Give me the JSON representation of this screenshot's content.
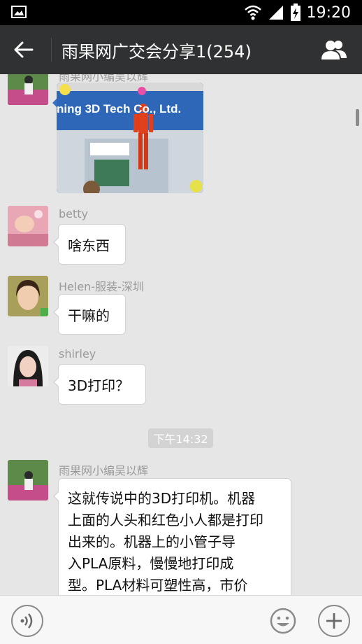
{
  "status_bar": {
    "time": "19:20",
    "icons": [
      "image-icon",
      "wifi-icon",
      "signal-icon",
      "battery-charging-icon"
    ]
  },
  "header": {
    "back_icon": "arrow-left-icon",
    "title": "雨果网广交会分享1(254)",
    "members_icon": "people-icon"
  },
  "messages": [
    {
      "sender": "雨果网小编吴以辉",
      "type": "image",
      "image_text": "ning 3D Tech Co., Ltd."
    },
    {
      "sender": "betty",
      "type": "text",
      "text": "啥东西"
    },
    {
      "sender": "Helen-服装-深圳",
      "type": "text",
      "text": "干嘛的"
    },
    {
      "sender": "shirley",
      "type": "text",
      "text": "3D打印？"
    }
  ],
  "timestamp": "下午14:32",
  "long_message": {
    "sender": "雨果网小编吴以辉",
    "lines": [
      "这就传说中的3D打印机。机器",
      "上面的人头和红色小人都是打印",
      "出来的。机器上的小管子导",
      "入PLA原料，慢慢地打印成",
      "型。PLA材料可塑性高，市价"
    ]
  },
  "input_bar": {
    "voice_icon": "voice-icon",
    "emoji_icon": "emoji-icon",
    "plus_icon": "plus-icon"
  },
  "colors": {
    "title_bar": "#2f3132",
    "chat_bg": "#e6e6e6",
    "bubble": "#ffffff",
    "sender_text": "#9a9a9a"
  }
}
